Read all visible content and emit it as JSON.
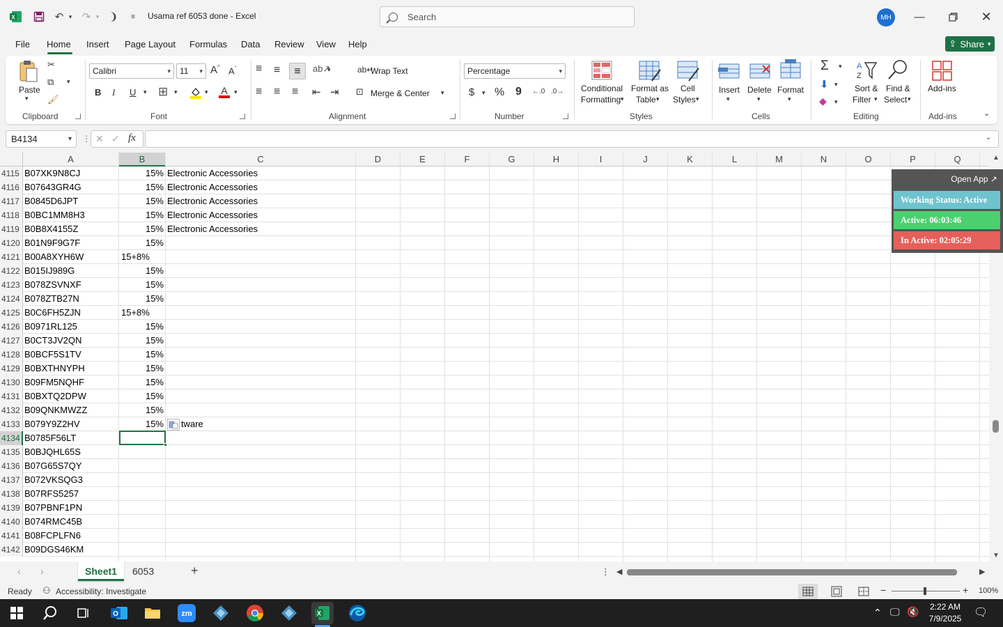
{
  "window": {
    "title": "Usama ref 6053 done  -  Excel",
    "avatar_initials": "MH",
    "search_placeholder": "Search"
  },
  "menu_tabs": [
    "File",
    "Home",
    "Insert",
    "Page Layout",
    "Formulas",
    "Data",
    "Review",
    "View",
    "Help"
  ],
  "share_label": "Share",
  "ribbon": {
    "clipboard": {
      "label": "Clipboard",
      "paste": "Paste"
    },
    "font": {
      "label": "Font",
      "font_name": "Calibri",
      "font_size": "11",
      "bold": "B",
      "italic": "I",
      "underline": "U"
    },
    "alignment": {
      "label": "Alignment",
      "wrap_text": "Wrap Text",
      "merge_center": "Merge & Center"
    },
    "number": {
      "label": "Number",
      "format": "Percentage",
      "currency": "$",
      "percent": "%",
      "comma": "9"
    },
    "styles": {
      "label": "Styles",
      "conditional_1": "Conditional",
      "conditional_2": "Formatting",
      "format_table_1": "Format as",
      "format_table_2": "Table",
      "cell_styles_1": "Cell",
      "cell_styles_2": "Styles"
    },
    "cells": {
      "label": "Cells",
      "insert": "Insert",
      "delete": "Delete",
      "format": "Format"
    },
    "editing": {
      "label": "Editing",
      "sort_1": "Sort &",
      "sort_2": "Filter",
      "find_1": "Find &",
      "find_2": "Select"
    },
    "addins": {
      "label": "Add-ins",
      "addins": "Add-ins"
    }
  },
  "formula_bar": {
    "name_box": "B4134",
    "fx": "fx",
    "formula": ""
  },
  "columns": [
    "A",
    "B",
    "C",
    "D",
    "E",
    "F",
    "G",
    "H",
    "I",
    "J",
    "K",
    "L",
    "M",
    "N",
    "O",
    "P",
    "Q"
  ],
  "rows": [
    {
      "n": "4115",
      "a": "B07XK9N8CJ",
      "b": "15%",
      "c": "Electronic Accessories"
    },
    {
      "n": "4116",
      "a": "B07643GR4G",
      "b": "15%",
      "c": "Electronic Accessories"
    },
    {
      "n": "4117",
      "a": "B0845D6JPT",
      "b": "15%",
      "c": "Electronic Accessories"
    },
    {
      "n": "4118",
      "a": "B0BC1MM8H3",
      "b": "15%",
      "c": "Electronic Accessories"
    },
    {
      "n": "4119",
      "a": "B0B8X4155Z",
      "b": "15%",
      "c": "Electronic Accessories"
    },
    {
      "n": "4120",
      "a": "B01N9F9G7F",
      "b": "15%",
      "c": ""
    },
    {
      "n": "4121",
      "a": "B00A8XYH6W",
      "b": "15+8%",
      "c": ""
    },
    {
      "n": "4122",
      "a": "B015IJ989G",
      "b": "15%",
      "c": ""
    },
    {
      "n": "4123",
      "a": "B078ZSVNXF",
      "b": "15%",
      "c": ""
    },
    {
      "n": "4124",
      "a": "B078ZTB27N",
      "b": "15%",
      "c": ""
    },
    {
      "n": "4125",
      "a": "B0C6FH5ZJN",
      "b": "15+8%",
      "c": ""
    },
    {
      "n": "4126",
      "a": "B0971RL125",
      "b": "15%",
      "c": ""
    },
    {
      "n": "4127",
      "a": "B0CT3JV2QN",
      "b": "15%",
      "c": ""
    },
    {
      "n": "4128",
      "a": "B0BCF5S1TV",
      "b": "15%",
      "c": ""
    },
    {
      "n": "4129",
      "a": "B0BXTHNYPH",
      "b": "15%",
      "c": ""
    },
    {
      "n": "4130",
      "a": "B09FM5NQHF",
      "b": "15%",
      "c": ""
    },
    {
      "n": "4131",
      "a": "B0BXTQ2DPW",
      "b": "15%",
      "c": ""
    },
    {
      "n": "4132",
      "a": "B09QNKMWZZ",
      "b": "15%",
      "c": ""
    },
    {
      "n": "4133",
      "a": "B079Y9Z2HV",
      "b": "15%",
      "c": "tware"
    },
    {
      "n": "4134",
      "a": "B0785F56LT",
      "b": "",
      "c": ""
    },
    {
      "n": "4135",
      "a": "B0BJQHL65S",
      "b": "",
      "c": ""
    },
    {
      "n": "4136",
      "a": "B07G65S7QY",
      "b": "",
      "c": ""
    },
    {
      "n": "4137",
      "a": "B072VKSQG3",
      "b": "",
      "c": ""
    },
    {
      "n": "4138",
      "a": "B07RFS5257",
      "b": "",
      "c": ""
    },
    {
      "n": "4139",
      "a": "B07PBNF1PN",
      "b": "",
      "c": ""
    },
    {
      "n": "4140",
      "a": "B074RMC45B",
      "b": "",
      "c": ""
    },
    {
      "n": "4141",
      "a": "B08FCPLFN6",
      "b": "",
      "c": ""
    },
    {
      "n": "4142",
      "a": "B09DGS46KM",
      "b": "",
      "c": ""
    }
  ],
  "tracker": {
    "open_app": "Open App ↗",
    "working_status": "Working Status: Active",
    "active": "Active: 06:03:46",
    "inactive": "In Active: 02:05:29",
    "colors": {
      "status": "#6fc3cf",
      "active": "#4ccf6f",
      "inactive": "#e5605a"
    }
  },
  "sheet_tabs": [
    "Sheet1",
    "6053"
  ],
  "status": {
    "ready": "Ready",
    "accessibility": "Accessibility: Investigate",
    "zoom": "100%"
  },
  "taskbar": {
    "time": "2:22 AM",
    "date": "7/9/2025"
  },
  "accent": "#217346"
}
